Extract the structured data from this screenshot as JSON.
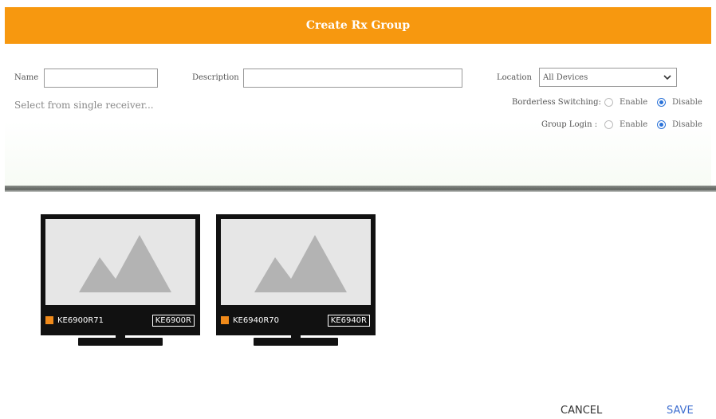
{
  "dialog": {
    "title": "Create Rx Group"
  },
  "form": {
    "name_label": "Name",
    "name_value": "",
    "description_label": "Description",
    "description_value": "",
    "location_label": "Location",
    "location_value": "All Devices",
    "hint": "Select from single receiver...",
    "borderless_label": "Borderless Switching:",
    "group_login_label": "Group Login :",
    "enable_label": "Enable",
    "disable_label": "Disable",
    "borderless_selected": "Disable",
    "group_login_selected": "Disable"
  },
  "devices": [
    {
      "name": "KE6900R71",
      "model": "KE6900R",
      "status_color": "#f08a1a"
    },
    {
      "name": "KE6940R70",
      "model": "KE6940R",
      "status_color": "#f08a1a"
    }
  ],
  "footer": {
    "cancel_label": "CANCEL",
    "save_label": "SAVE"
  },
  "colors": {
    "header": "#f7980f",
    "accent": "#2a72d8"
  }
}
